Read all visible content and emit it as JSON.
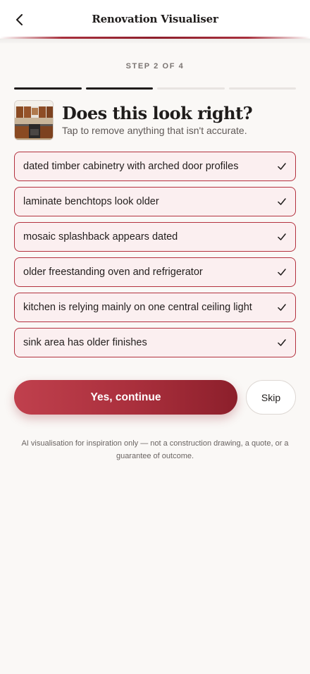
{
  "header": {
    "title": "Renovation Visualiser",
    "back_icon": "chevron-left-icon"
  },
  "step": {
    "label": "STEP 2 OF 4",
    "current": 2,
    "total": 4
  },
  "review": {
    "title": "Does this look right?",
    "subtitle": "Tap to remove anything that isn't accurate.",
    "thumbnail": "kitchen-photo-thumbnail"
  },
  "issues": [
    {
      "label": "dated timber cabinetry with arched door profiles",
      "selected": true
    },
    {
      "label": "laminate benchtops look older",
      "selected": true
    },
    {
      "label": "mosaic splashback appears dated",
      "selected": true
    },
    {
      "label": "older freestanding oven and refrigerator",
      "selected": true
    },
    {
      "label": "kitchen is relying mainly on one central ceiling light",
      "selected": true
    },
    {
      "label": "sink area has older finishes",
      "selected": true
    }
  ],
  "actions": {
    "continue_label": "Yes, continue",
    "skip_label": "Skip"
  },
  "disclaimer": "AI visualisation for inspiration only — not a construction drawing, a quote, or a guarantee of outcome.",
  "colors": {
    "accent": "#a92f3c",
    "accent_dark": "#8c1f2b",
    "chip_bg": "#fbeff0",
    "page_bg": "#faf8f6"
  }
}
